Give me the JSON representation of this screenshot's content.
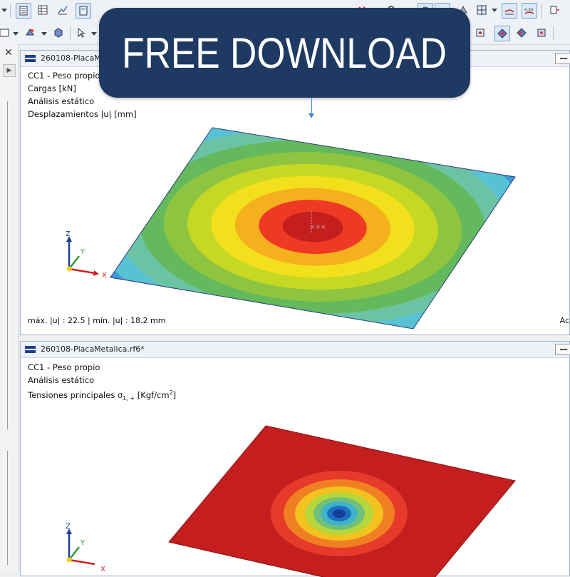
{
  "banner": {
    "text": "FREE DOWNLOAD"
  },
  "windows": [
    {
      "title": "260108-PlacaMe",
      "info_lines": [
        "CC1 - Peso propio",
        "Cargas [kN]",
        "Análisis estático",
        "Desplazamientos |u| [mm]"
      ],
      "footer": "máx. |u| : 22.5 | mín. |u| : 18.2 mm",
      "cutoff_label": "Ac",
      "axes": {
        "z": "Z",
        "y": "Y",
        "x": "X"
      },
      "palette": [
        "#1f3f9a",
        "#2f6fc4",
        "#3c98d6",
        "#59c1d4",
        "#6cc3a4",
        "#63b95b",
        "#8ec43f",
        "#c6d823",
        "#f3e01c",
        "#f5b01d",
        "#ee3a24",
        "#c41e1e"
      ]
    },
    {
      "title": "260108-PlacaMetalica.rf6*",
      "info_lines": [
        "CC1 - Peso propio",
        "Análisis estático"
      ],
      "stress_label": "Tensiones principales σ",
      "stress_sub": "1, +",
      "stress_unit": " [Kgf/cm",
      "stress_sup": "2",
      "stress_close": "]",
      "axes": {
        "z": "Z",
        "y": "Y",
        "x": "X"
      },
      "palette": [
        "#c41e1e",
        "#e63a2a",
        "#f07f23",
        "#f2c21f",
        "#b7d63c",
        "#6fc07a",
        "#3fb3c8",
        "#1d6fc2",
        "#173c9a"
      ]
    }
  ]
}
